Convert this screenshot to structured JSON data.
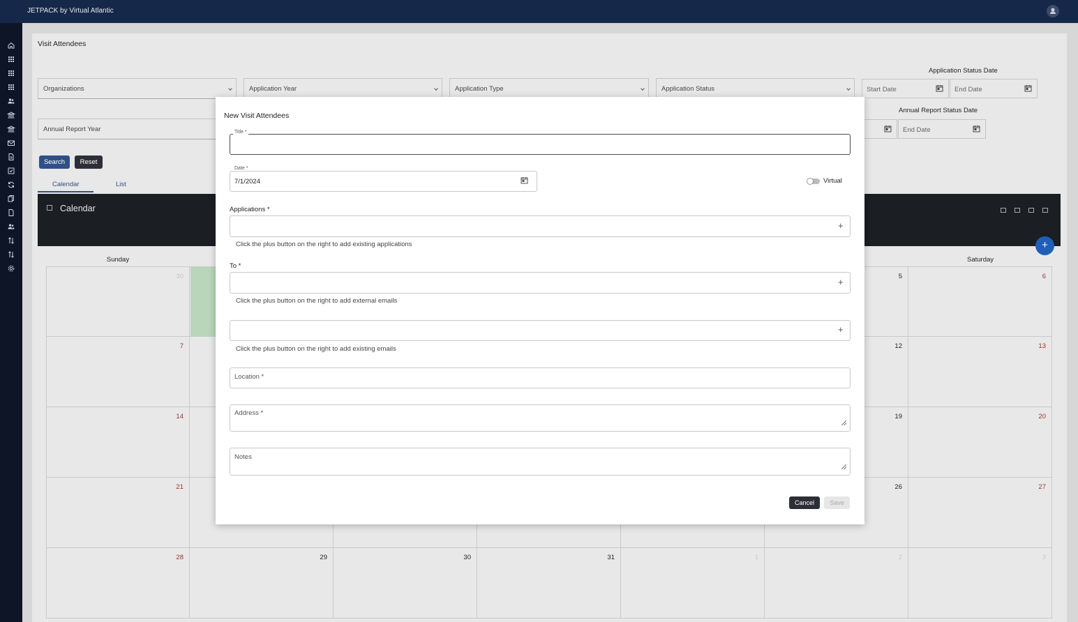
{
  "app": {
    "title": "JETPACK by Virtual Atlantic"
  },
  "sidebar": {
    "icons": [
      "home-icon",
      "grid-icon",
      "grid-icon",
      "grid-icon",
      "users-icon",
      "bank-icon",
      "bank-icon",
      "mail-icon",
      "document-icon",
      "checkbox-icon",
      "refresh-icon",
      "copy-icon",
      "file-icon",
      "users-icon",
      "sort-icon",
      "sort-icon",
      "gear-icon"
    ]
  },
  "page": {
    "title": "Visit Attendees",
    "filters": {
      "organizations": "Organizations",
      "application_year": "Application Year",
      "application_type": "Application Type",
      "application_status": "Application Status",
      "annual_report_year": "Annual Report Year",
      "application_status_date_label": "Application Status Date",
      "annual_report_status_date_label": "Annual Report Status Date",
      "start_date": "Start Date",
      "end_date": "End Date"
    },
    "buttons": {
      "search": "Search",
      "reset": "Reset"
    },
    "tabs": [
      "Calendar",
      "List"
    ],
    "calendar": {
      "title": "Calendar",
      "weekdays": {
        "sunday": "Sunday",
        "saturday": "Saturday"
      },
      "add_label": "+",
      "weeks": [
        [
          "30",
          "",
          "",
          "",
          "",
          "5",
          "6"
        ],
        [
          "7",
          "",
          "",
          "",
          "",
          "12",
          "13"
        ],
        [
          "14",
          "",
          "",
          "",
          "",
          "19",
          "20"
        ],
        [
          "21",
          "",
          "",
          "",
          "",
          "26",
          "27"
        ],
        [
          "28",
          "29",
          "30",
          "31",
          "1",
          "2",
          "3"
        ]
      ]
    }
  },
  "modal": {
    "title": "New Visit Attendees",
    "title_field": {
      "label": "Title *",
      "value": ""
    },
    "date_field": {
      "label": "Date *",
      "value": "7/1/2024"
    },
    "virtual": {
      "label": "Virtual",
      "checked": false
    },
    "applications": {
      "label": "Applications *",
      "hint": "Click the plus button on the right to add existing applications"
    },
    "to": {
      "label": "To *",
      "hint": "Click the plus button on the right to add external emails"
    },
    "existing_emails": {
      "hint": "Click the plus button on the right to add existing emails"
    },
    "location": {
      "placeholder": "Location *"
    },
    "address": {
      "placeholder": "Address *"
    },
    "notes": {
      "placeholder": "Notes"
    },
    "plus": "+",
    "buttons": {
      "cancel": "Cancel",
      "save": "Save"
    }
  }
}
